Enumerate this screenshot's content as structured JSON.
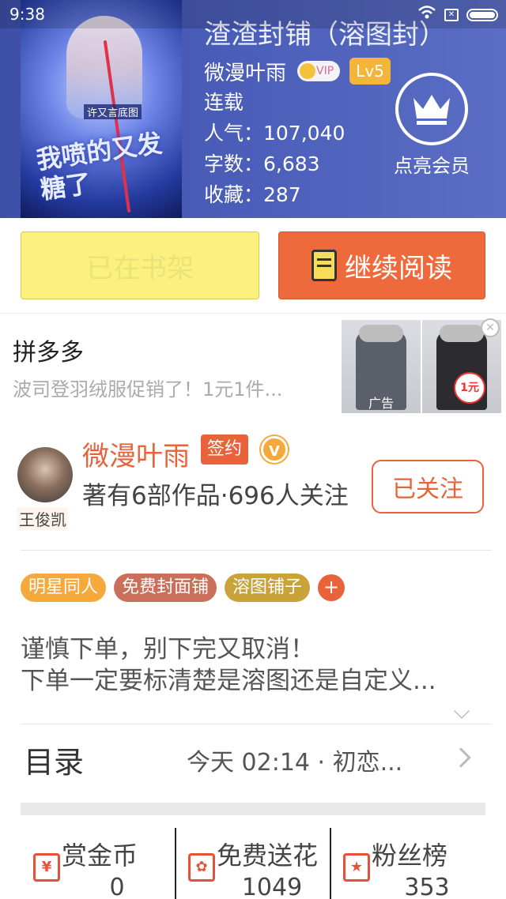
{
  "status_bar": {
    "time": "9:38"
  },
  "book": {
    "title": "渣渣封铺（溶图封）",
    "author": "微漫叶雨",
    "vip_label": "VIP",
    "level": "Lv5",
    "status": "连载",
    "popularity": "人气：107,040",
    "word_count": "字数：6,683",
    "favorites": "收藏：287",
    "cover_tag": "许又言底图",
    "cover_title": "我喷的又发糖了"
  },
  "member": {
    "label": "点亮会员"
  },
  "actions": {
    "shelf_label": "已在书架",
    "read_label": "继续阅读"
  },
  "ad": {
    "title": "拼多多",
    "description": "波司登羽绒服促销了！1元1件...",
    "label": "广告",
    "price_tag": "1元"
  },
  "author_card": {
    "name": "微漫叶雨",
    "sign_badge": "签约",
    "verify_mark": "V",
    "stats": "著有6部作品·696人关注",
    "avatar_name": "王俊凯",
    "follow_label": "已关注",
    "tags": [
      "明星同人",
      "免费封面铺",
      "溶图铺子"
    ],
    "tag_add": "+",
    "description_lines": [
      "谨慎下单，别下完又取消！",
      "下单一定要标清楚是溶图还是自定义..."
    ]
  },
  "toc": {
    "label": "目录",
    "latest": "今天 02:14 · 初恋..."
  },
  "bottom_stats": [
    {
      "label": "赏金币",
      "value": "0",
      "icon": "¥"
    },
    {
      "label": "免费送花",
      "value": "1049",
      "icon": "✿"
    },
    {
      "label": "粉丝榜",
      "value": "353",
      "icon": "★"
    }
  ],
  "colors": {
    "header_bg": "#4a5db8",
    "accent": "#e8623a",
    "shelf_button": "#fcf07e",
    "read_button": "#ee6a3c",
    "tag_colors": [
      "#f4a93a",
      "#c9705a",
      "#c9a23a"
    ]
  }
}
